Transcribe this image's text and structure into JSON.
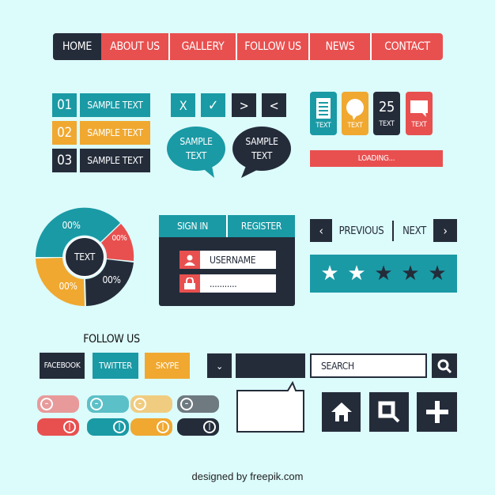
{
  "colors": {
    "background": "#dcfbfb",
    "teal": "#1a9aa5",
    "orange": "#f0a830",
    "dark": "#242c3a",
    "red": "#e8504f"
  },
  "nav": {
    "items": [
      "HOME",
      "ABOUT US",
      "GALLERY",
      "FOLLOW US",
      "NEWS",
      "CONTACT"
    ],
    "active": "HOME"
  },
  "numbered_list": [
    {
      "num": "01",
      "label": "SAMPLE TEXT",
      "color": "teal"
    },
    {
      "num": "02",
      "label": "SAMPLE TEXT",
      "color": "orange"
    },
    {
      "num": "03",
      "label": "SAMPLE TEXT",
      "color": "dark"
    }
  ],
  "icon_buttons": [
    {
      "glyph": "X",
      "icon": "close-icon"
    },
    {
      "glyph": "✓",
      "icon": "check-icon"
    },
    {
      "glyph": ">",
      "icon": "chevron-right-icon"
    },
    {
      "glyph": "<",
      "icon": "chevron-left-icon"
    }
  ],
  "bubbles": [
    {
      "line1": "SAMPLE",
      "line2": "TEXT"
    },
    {
      "line1": "SAMPLE",
      "line2": "TEXT"
    }
  ],
  "cards": [
    {
      "label": "TEXT",
      "icon": "document-icon"
    },
    {
      "label": "TEXT",
      "icon": "speech-bubble-icon"
    },
    {
      "label": "TEXT",
      "value": "25"
    },
    {
      "label": "TEXT",
      "icon": "chat-icon"
    }
  ],
  "loading": "LOADING...",
  "donut": {
    "center": "TEXT",
    "labels": [
      "00%",
      "00%",
      "00%",
      "00%"
    ]
  },
  "login": {
    "tabs": [
      "SIGN IN",
      "REGISTER"
    ],
    "username": "USERNAME",
    "password": "..........."
  },
  "pager": {
    "previous": "PREVIOUS",
    "next": "NEXT"
  },
  "rating": {
    "value": 2,
    "max": 5
  },
  "follow": {
    "title": "FOLLOW US",
    "buttons": [
      "FACEBOOK",
      "TWITTER",
      "SKYPE"
    ]
  },
  "search": {
    "placeholder": "SEARCH"
  },
  "toggles": {
    "off": [
      "#e89a9a",
      "#5cc0c8",
      "#f0cc80",
      "#6e7a80"
    ],
    "on": [
      "#e8504f",
      "#1a9aa5",
      "#f0a830",
      "#242c3a"
    ]
  },
  "credit": "designed by freepik.com"
}
